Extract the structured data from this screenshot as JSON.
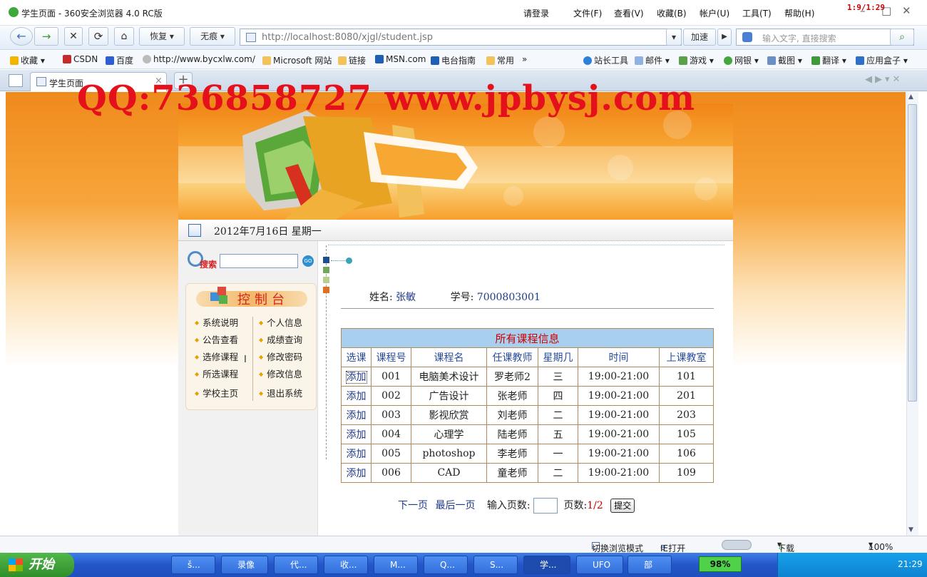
{
  "window": {
    "title": "学生页面 - 360安全浏览器 4.0 RC版",
    "menu": [
      "请登录",
      "文件(F)",
      "查看(V)",
      "收藏(B)",
      "帐户(U)",
      "工具(T)",
      "帮助(H)"
    ],
    "time_badge": "1:9/1:29"
  },
  "nav": {
    "restore_label": "恢复",
    "notrace_label": "无痕",
    "url": "http://localhost:8080/xjgl/student.jsp",
    "accelerate_label": "加速",
    "search_placeholder": "输入文字, 直接搜索"
  },
  "favorites": {
    "left": [
      "收藏",
      "CSDN",
      "百度",
      "http://www.bycxlw.com/",
      "Microsoft 网站",
      "链接",
      "MSN.com",
      "电台指南",
      "常用"
    ],
    "right": [
      "站长工具",
      "邮件",
      "游戏",
      "网银",
      "截图",
      "翻译",
      "应用盒子"
    ]
  },
  "tab": {
    "label": "学生页面"
  },
  "watermark": "QQ:736858727 www.jpbysj.com",
  "page": {
    "date": "2012年7月16日  星期一",
    "search_label": "搜索",
    "control_title": "控制台",
    "menu_left": [
      "系统说明",
      "公告查看",
      "选修课程",
      "所选课程",
      "学校主页"
    ],
    "menu_right": [
      "个人信息",
      "成绩查询",
      "修改密码",
      "修改信息",
      "退出系统"
    ],
    "student": {
      "name_label": "姓名:",
      "name": "张敏",
      "id_label": "学号:",
      "id": "7000803001"
    },
    "table": {
      "caption": "所有课程信息",
      "headers": [
        "选课",
        "课程号",
        "课程名",
        "任课教师",
        "星期几",
        "时间",
        "上课教室"
      ],
      "rows": [
        [
          "添加",
          "001",
          "电脑美术设计",
          "罗老师2",
          "三",
          "19:00-21:00",
          "101"
        ],
        [
          "添加",
          "002",
          "广告设计",
          "张老师",
          "四",
          "19:00-21:00",
          "201"
        ],
        [
          "添加",
          "003",
          "影视欣赏",
          "刘老师",
          "二",
          "19:00-21:00",
          "203"
        ],
        [
          "添加",
          "004",
          "心理学",
          "陆老师",
          "五",
          "19:00-21:00",
          "105"
        ],
        [
          "添加",
          "005",
          "photoshop",
          "李老师",
          "一",
          "19:00-21:00",
          "106"
        ],
        [
          "添加",
          "006",
          "CAD",
          "童老师",
          "二",
          "19:00-21:00",
          "109"
        ]
      ]
    },
    "pager": {
      "next": "下一页",
      "last": "最后一页",
      "input_label": "输入页数:",
      "pages_label": "页数:",
      "pages_value": "1/2",
      "submit": "提交"
    }
  },
  "status": {
    "mode": "切换浏览模式",
    "ie": "IE打开",
    "download": "下载",
    "zoom": "100%"
  },
  "taskbar": {
    "start": "开始",
    "tasks": [
      "š...",
      "录像",
      "代...",
      "收...",
      "M...",
      "Q...",
      "S...",
      "学...",
      "UFO",
      "部"
    ],
    "battery": "98%",
    "clock": "21:29"
  }
}
